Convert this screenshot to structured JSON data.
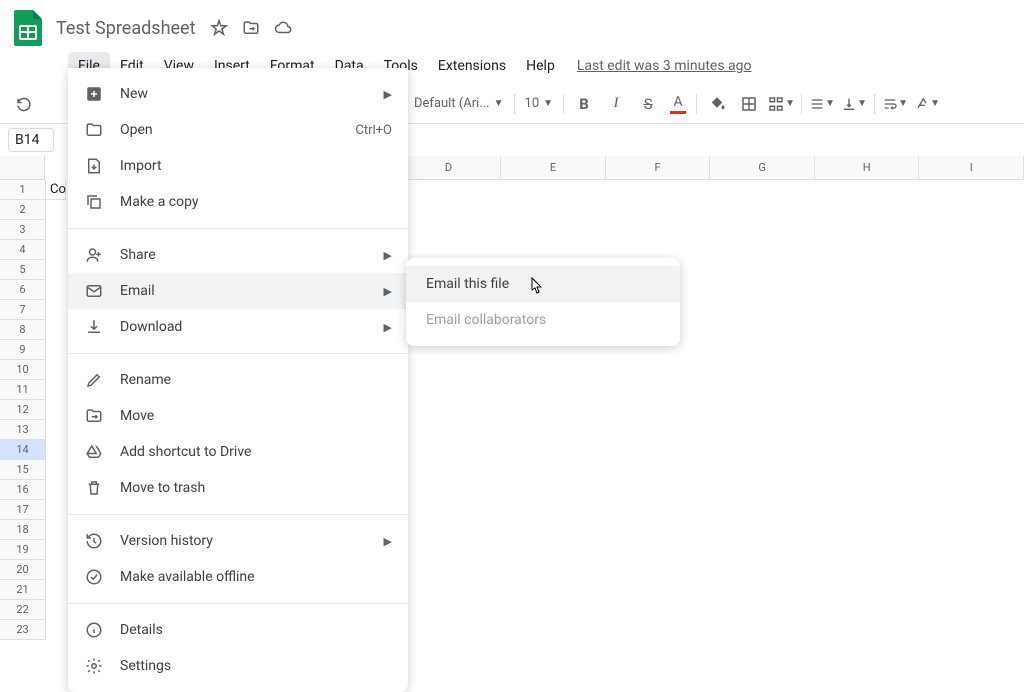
{
  "doc": {
    "title": "Test Spreadsheet"
  },
  "menubar": {
    "items": [
      "File",
      "Edit",
      "View",
      "Insert",
      "Format",
      "Data",
      "Tools",
      "Extensions",
      "Help"
    ],
    "last_edit": "Last edit was 3 minutes ago"
  },
  "toolbar": {
    "font": "Default (Ari...",
    "font_size": "10"
  },
  "name_box": "B14",
  "columns": [
    "D",
    "E",
    "F",
    "G",
    "H",
    "I"
  ],
  "row_count": 23,
  "selected_row": 14,
  "cell_A1": "Co",
  "file_menu": {
    "groups": [
      [
        {
          "icon": "plus-box",
          "label": "New",
          "submenu": true
        },
        {
          "icon": "folder",
          "label": "Open",
          "shortcut": "Ctrl+O"
        },
        {
          "icon": "import",
          "label": "Import"
        },
        {
          "icon": "copy",
          "label": "Make a copy"
        }
      ],
      [
        {
          "icon": "person-plus",
          "label": "Share",
          "submenu": true
        },
        {
          "icon": "mail",
          "label": "Email",
          "submenu": true,
          "hover": true
        },
        {
          "icon": "download",
          "label": "Download",
          "submenu": true
        }
      ],
      [
        {
          "icon": "pencil",
          "label": "Rename"
        },
        {
          "icon": "folder-move",
          "label": "Move"
        },
        {
          "icon": "drive-add",
          "label": "Add shortcut to Drive"
        },
        {
          "icon": "trash",
          "label": "Move to trash"
        }
      ],
      [
        {
          "icon": "history",
          "label": "Version history",
          "submenu": true
        },
        {
          "icon": "offline",
          "label": "Make available offline"
        }
      ],
      [
        {
          "icon": "info",
          "label": "Details"
        },
        {
          "icon": "gear",
          "label": "Settings"
        }
      ]
    ]
  },
  "email_submenu": {
    "items": [
      {
        "label": "Email this file",
        "hover": true
      },
      {
        "label": "Email collaborators",
        "disabled": true
      }
    ]
  }
}
